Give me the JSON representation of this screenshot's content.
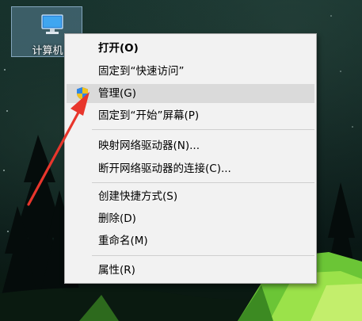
{
  "desktop": {
    "icon_label": "计算机",
    "icon_name": "computer-monitor-icon"
  },
  "context_menu": {
    "items": [
      {
        "label": "打开(O)",
        "bold": true
      },
      {
        "label": "固定到“快速访问”"
      },
      {
        "label": "管理(G)",
        "icon": "uac-shield-icon",
        "highlighted": true
      },
      {
        "label": "固定到“开始”屏幕(P)"
      },
      {
        "label": "映射网络驱动器(N)..."
      },
      {
        "label": "断开网络驱动器的连接(C)..."
      },
      {
        "label": "创建快捷方式(S)"
      },
      {
        "label": "删除(D)"
      },
      {
        "label": "重命名(M)"
      },
      {
        "label": "属性(R)"
      }
    ]
  },
  "colors": {
    "menu_background": "#f2f2f2",
    "menu_highlight": "#dadada",
    "annotation_arrow": "#e8362c",
    "icon_selection": "#7aa5c8"
  }
}
